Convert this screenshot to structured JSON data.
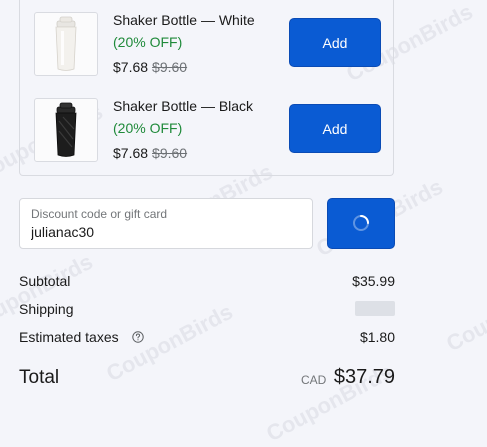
{
  "products": [
    {
      "title": "Shaker Bottle — White",
      "discount": "(20% OFF)",
      "price": "$7.68",
      "compare_price": "$9.60",
      "add_label": "Add",
      "image": "white-shaker-bottle"
    },
    {
      "title": "Shaker Bottle — Black",
      "discount": "(20% OFF)",
      "price": "$7.68",
      "compare_price": "$9.60",
      "add_label": "Add",
      "image": "black-shaker-bottle"
    }
  ],
  "discount": {
    "placeholder": "Discount code or gift card",
    "value": "julianac30",
    "apply_icon": "loading-spinner-icon"
  },
  "summary": {
    "subtotal_label": "Subtotal",
    "subtotal_value": "$35.99",
    "shipping_label": "Shipping",
    "taxes_label": "Estimated taxes",
    "taxes_value": "$1.80",
    "total_label": "Total",
    "total_currency": "CAD",
    "total_value": "$37.79"
  },
  "watermark": "CouponBirds",
  "colors": {
    "accent": "#0a5bd3",
    "discount_green": "#1f8a3a",
    "background": "#f4f5fa"
  }
}
